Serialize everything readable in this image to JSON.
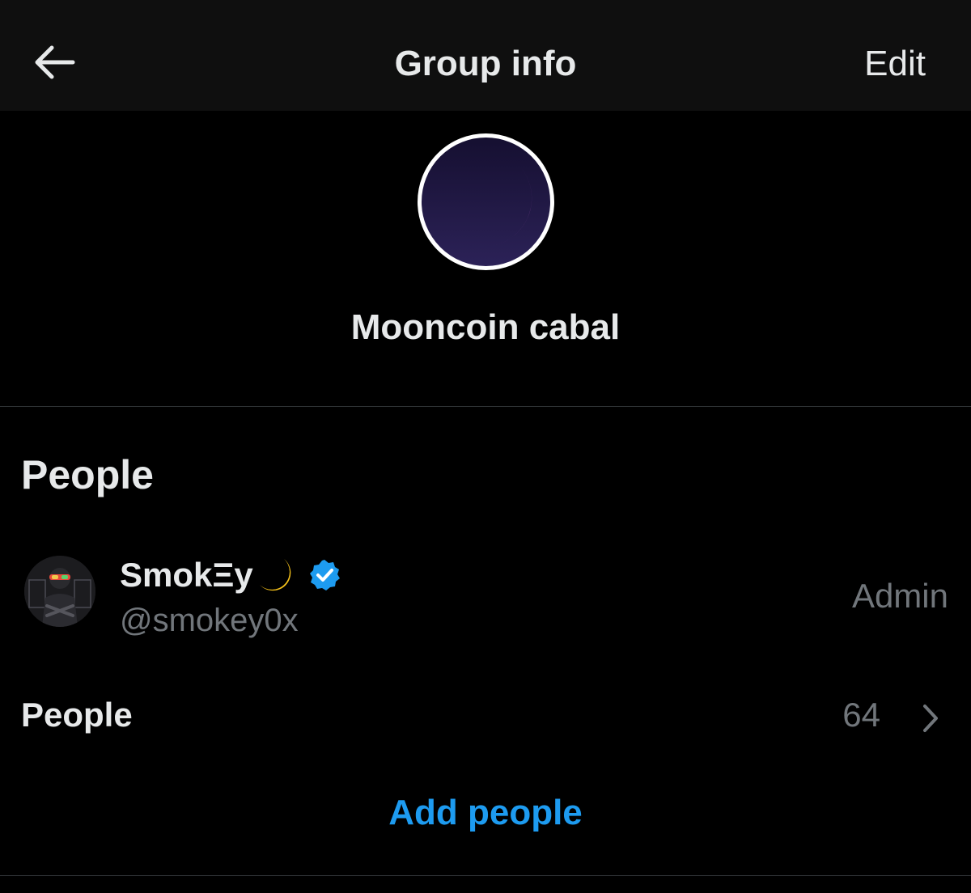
{
  "header": {
    "title": "Group info",
    "edit_label": "Edit",
    "back_icon": "arrow-left-icon"
  },
  "group": {
    "name": "Mooncoin cabal",
    "avatar_icon": "crescent-moon-icon",
    "avatar_bg": "#1f1840",
    "moon_color": "#f06ef0"
  },
  "people_section": {
    "heading": "People",
    "members": [
      {
        "display_name": "SmokΞy",
        "name_emoji": "crescent-moon-emoji",
        "handle": "@smokey0x",
        "role": "Admin",
        "verified": true
      }
    ],
    "people_row_label": "People",
    "people_count": "64",
    "add_people_label": "Add people"
  },
  "colors": {
    "background": "#000000",
    "header_bg": "#0f0f0f",
    "primary_text": "#e7e9ea",
    "secondary_text": "#71767b",
    "accent": "#1d9bf0",
    "divider": "#2f3336"
  }
}
